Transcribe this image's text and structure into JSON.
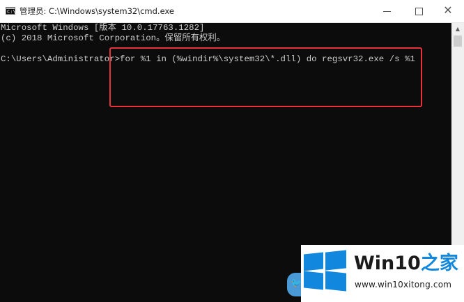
{
  "window": {
    "title": "管理员: C:\\Windows\\system32\\cmd.exe",
    "icon_glyph": "C:\\",
    "controls": {
      "minimize": "minimize-icon",
      "maximize": "maximize-icon",
      "close": "✕"
    }
  },
  "console": {
    "text": "Microsoft Windows [版本 10.0.17763.1282]\n(c) 2018 Microsoft Corporation。保留所有权利。\n\nC:\\Users\\Administrator>for %1 in (%windir%\\system32\\*.dll) do regsvr32.exe /s %1",
    "background": "#0c0c0c",
    "foreground": "#cccccc"
  },
  "scrollbar": {
    "up_arrow": "▲"
  },
  "annotation": {
    "color": "#e8323c"
  },
  "watermark": {
    "brand": "Win10",
    "accent": "之家",
    "url": "www.win10xitong.com",
    "accent_color": "#1188dd",
    "bird_glyph": "🐦"
  }
}
